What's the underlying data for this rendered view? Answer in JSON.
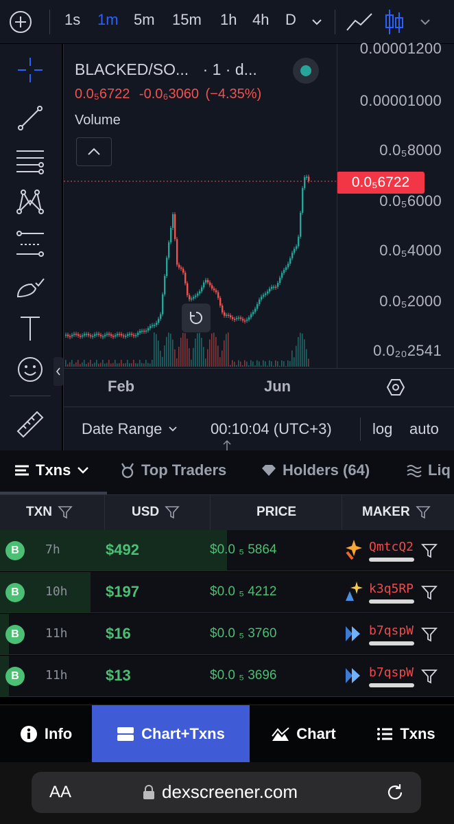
{
  "toolbar": {
    "timeframes": [
      "1s",
      "1m",
      "5m",
      "15m",
      "1h",
      "4h",
      "D"
    ],
    "active_timeframe": "1m"
  },
  "chart": {
    "symbol": "BLACKED/SO...",
    "interval": "· 1 · d...",
    "status_color": "#26a69a",
    "price": "0.0₅6722",
    "change": "-0.0₆3060",
    "change_pct": "(−4.35%)",
    "indicator": "Volume",
    "price_tag": "0.0₅6722",
    "y_labels": [
      "0.00001200",
      "0.00001000",
      "0.0₅8000",
      "0.0₅6000",
      "0.0₅4000",
      "0.0₅2000",
      "0.0₂₀2541"
    ],
    "x_labels": [
      "Feb",
      "Jun"
    ],
    "date_range_label": "Date Range",
    "clock": "00:10:04 (UTC+3)",
    "log_label": "log",
    "auto_label": "auto",
    "up_color": "#26a69a",
    "down_color": "#ef5350"
  },
  "tabs": {
    "txns": "Txns",
    "top_traders": "Top Traders",
    "holders": "Holders (64)",
    "liquidity": "Liq"
  },
  "table": {
    "headers": {
      "txn": "TXN",
      "usd": "USD",
      "price": "PRICE",
      "maker": "MAKER"
    },
    "rows": [
      {
        "type": "B",
        "age": "7h",
        "usd": "$492",
        "price": "$0.0 ₅ 5864",
        "maker": "QmtcQ2",
        "bar": 0.5
      },
      {
        "type": "B",
        "age": "10h",
        "usd": "$197",
        "price": "$0.0 ₅ 4212",
        "maker": "k3q5RP",
        "bar": 0.2
      },
      {
        "type": "B",
        "age": "11h",
        "usd": "$16",
        "price": "$0.0 ₅ 3760",
        "maker": "b7qspW",
        "bar": 0.02
      },
      {
        "type": "B",
        "age": "11h",
        "usd": "$13",
        "price": "$0.0 ₅ 3696",
        "maker": "b7qspW",
        "bar": 0.02
      }
    ]
  },
  "bottom_nav": {
    "info": "Info",
    "chart_txns": "Chart+Txns",
    "chart": "Chart",
    "txns": "Txns",
    "active": "Chart+Txns",
    "active_color": "#3f5bd6"
  },
  "browser": {
    "text_size": "AA",
    "url": "dexscreener.com"
  }
}
